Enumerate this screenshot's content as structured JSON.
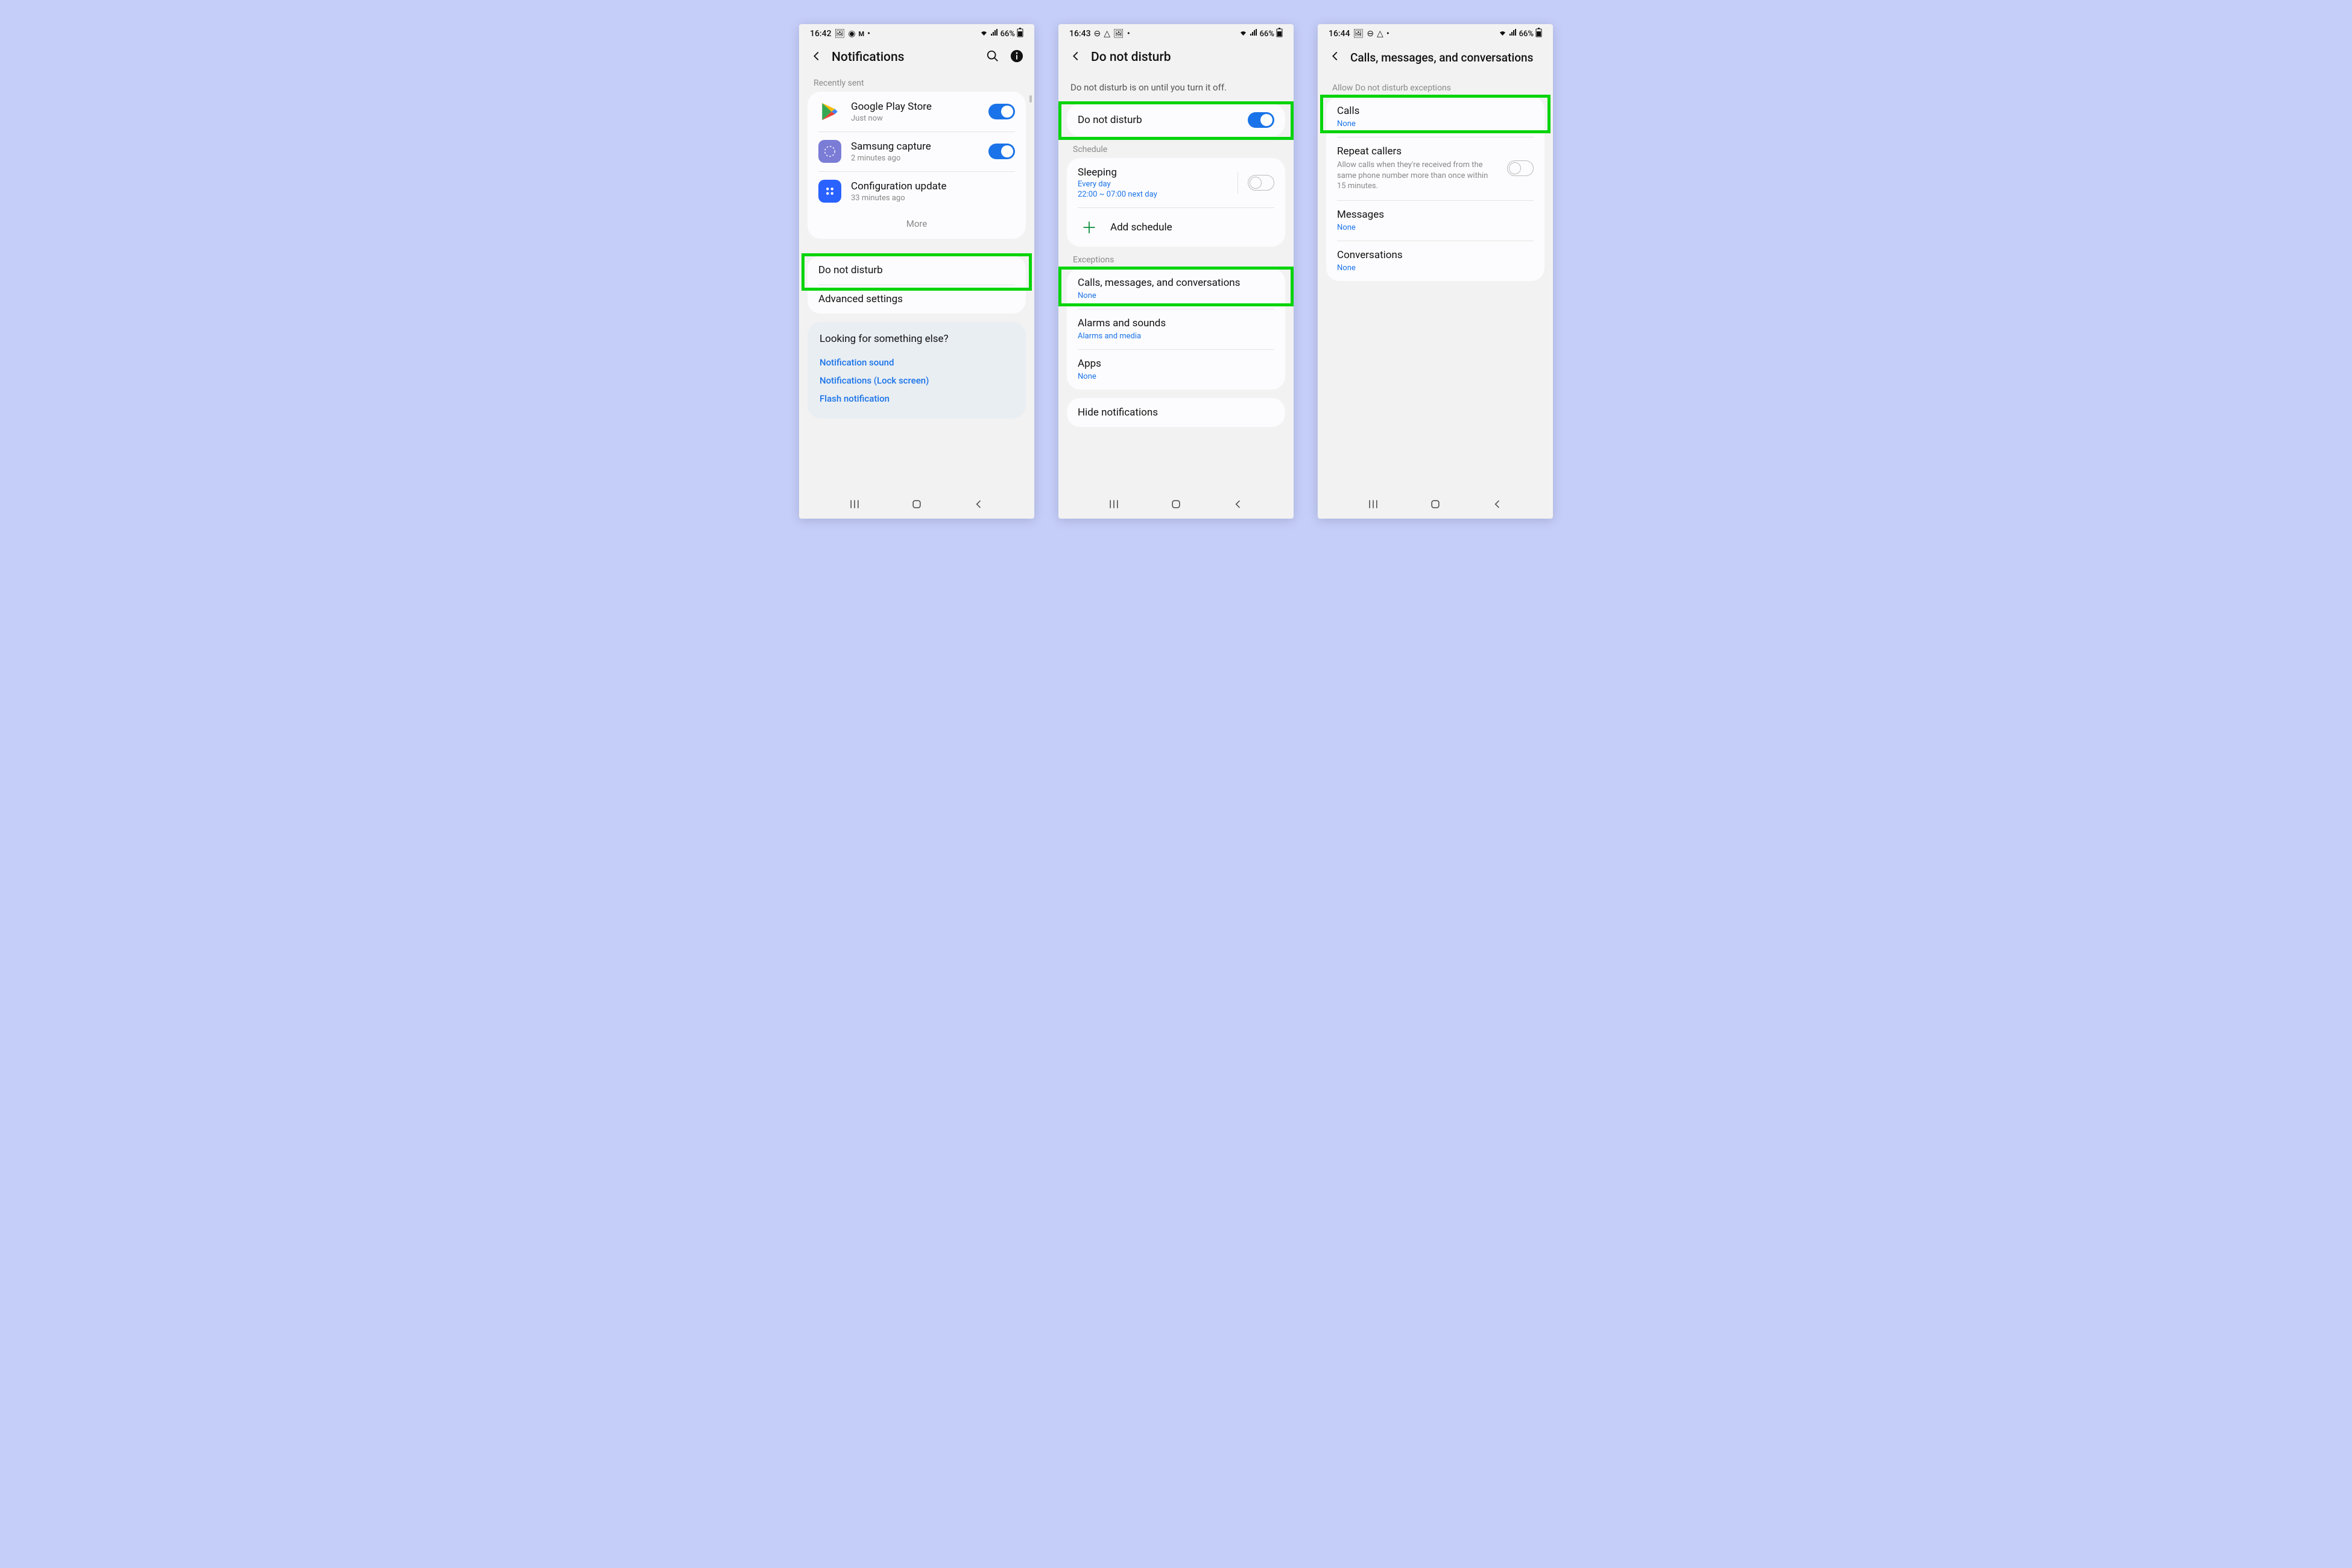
{
  "s1": {
    "time": "16:42",
    "battery": "66%",
    "title": "Notifications",
    "recently_sent": "Recently sent",
    "apps": [
      {
        "name": "Google Play Store",
        "when": "Just now"
      },
      {
        "name": "Samsung capture",
        "when": "2 minutes ago"
      },
      {
        "name": "Configuration update",
        "when": "33 minutes ago"
      }
    ],
    "more": "More",
    "dnd": "Do not disturb",
    "advanced": "Advanced settings",
    "looking": "Looking for something else?",
    "links": [
      "Notification sound",
      "Notifications (Lock screen)",
      "Flash notification"
    ]
  },
  "s2": {
    "time": "16:43",
    "battery": "66%",
    "title": "Do not disturb",
    "status": "Do not disturb is on until you turn it off.",
    "dnd_row": "Do not disturb",
    "schedule": "Schedule",
    "sleeping": "Sleeping",
    "sleeping_sub1": "Every day",
    "sleeping_sub2": "22:00 ~ 07:00 next day",
    "add_schedule": "Add schedule",
    "exceptions": "Exceptions",
    "calls_msgs": "Calls, messages, and conversations",
    "none": "None",
    "alarms": "Alarms and sounds",
    "alarms_sub": "Alarms and media",
    "apps": "Apps",
    "hide": "Hide notifications"
  },
  "s3": {
    "time": "16:44",
    "battery": "66%",
    "title": "Calls, messages, and conversations",
    "allow": "Allow Do not disturb exceptions",
    "calls": "Calls",
    "none": "None",
    "repeat": "Repeat callers",
    "repeat_desc": "Allow calls when they're received from the same phone number more than once within 15 minutes.",
    "messages": "Messages",
    "conversations": "Conversations"
  }
}
